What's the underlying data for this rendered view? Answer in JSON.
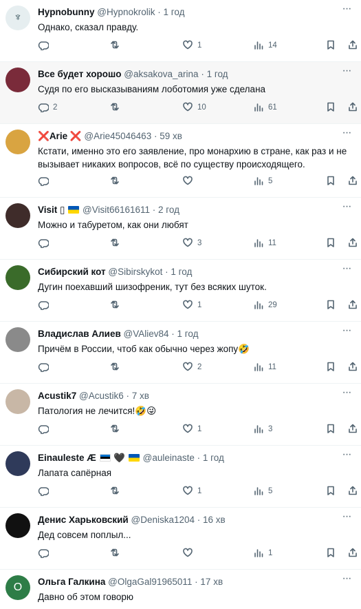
{
  "tweets": [
    {
      "name": "Hypnobunny",
      "handle": "@Hypnokrolik",
      "time": "1 год",
      "text": "Однако, сказал правду.",
      "replies": "",
      "retweets": "",
      "likes": "1",
      "views": "14",
      "avatar_color": "#e6eef0",
      "avatar_glyph": "♆",
      "avatar_fg": "#1d3a44",
      "highlight": false
    },
    {
      "name": "Все будет хорошо",
      "handle": "@aksakova_arina",
      "time": "1 год",
      "text": "Судя по его высказываниям лоботомия уже сделана",
      "replies": "2",
      "retweets": "",
      "likes": "10",
      "views": "61",
      "avatar_color": "#7a2b3a",
      "avatar_glyph": "",
      "avatar_fg": "#fff",
      "highlight": true
    },
    {
      "name": "Arie",
      "name_prefix": "❌",
      "name_suffix": "❌",
      "handle": "@Arie45046463",
      "time": "59 хв",
      "text": "Кстати, именно это его заявление, про монархию в стране, как раз и не вызывает никаких вопросов, всё по существу происходящего.",
      "replies": "",
      "retweets": "",
      "likes": "",
      "views": "5",
      "avatar_color": "#d9a441",
      "avatar_glyph": "",
      "avatar_fg": "#fff",
      "highlight": false
    },
    {
      "name": "Visit",
      "name_suffix": "▯",
      "flag": "ua",
      "handle": "@Visit66161611",
      "time": "2 год",
      "text": "Можно и табуретом, как они любят",
      "replies": "",
      "retweets": "",
      "likes": "3",
      "views": "11",
      "avatar_color": "#3f2c2a",
      "avatar_glyph": "",
      "avatar_fg": "#fff",
      "highlight": false
    },
    {
      "name": "Сибирский кот",
      "handle": "@Sibirskykot",
      "time": "1 год",
      "text": "Дугин поехавший шизофреник, тут без всяких шуток.",
      "replies": "",
      "retweets": "",
      "likes": "1",
      "views": "29",
      "avatar_color": "#3a6b2a",
      "avatar_glyph": "",
      "avatar_fg": "#fff",
      "highlight": false
    },
    {
      "name": "Владислав Алиев",
      "handle": "@VAliev84",
      "time": "1 год",
      "text": "Причём в России, чтоб как обычно через жопу🤣",
      "replies": "",
      "retweets": "",
      "likes": "2",
      "views": "11",
      "avatar_color": "#8a8a8a",
      "avatar_glyph": "",
      "avatar_fg": "#fff",
      "highlight": false
    },
    {
      "name": "Acustik7",
      "handle": "@Acustik6",
      "time": "7 хв",
      "text": "Патология не лечится!🤣😜",
      "replies": "",
      "retweets": "",
      "likes": "1",
      "views": "3",
      "avatar_color": "#c8b7a6",
      "avatar_glyph": "",
      "avatar_fg": "#fff",
      "highlight": false
    },
    {
      "name": "Einauleste Æ",
      "flag_ee": true,
      "heart": "🖤",
      "flag": "ua",
      "handle": "@auleinaste",
      "time": "1 год",
      "text": "Лапата сапёрная",
      "replies": "",
      "retweets": "",
      "likes": "1",
      "views": "5",
      "avatar_color": "#2f3a5a",
      "avatar_glyph": "",
      "avatar_fg": "#fff",
      "highlight": false
    },
    {
      "name": "Денис Харьковский",
      "handle": "@Deniska1204",
      "time": "16 хв",
      "text": "Дед совсем поплыл...",
      "replies": "",
      "retweets": "",
      "likes": "",
      "views": "1",
      "avatar_color": "#111111",
      "avatar_glyph": "",
      "avatar_fg": "#c0202a",
      "highlight": false
    },
    {
      "name": "Ольга Галкина",
      "handle": "@OlgaGal91965011",
      "time": "17 хв",
      "text": "Давно об этом говорю",
      "replies": "",
      "retweets": "",
      "likes": "",
      "views": "",
      "avatar_color": "#2e7d47",
      "avatar_glyph": "O",
      "avatar_fg": "#fff",
      "highlight": false
    }
  ]
}
